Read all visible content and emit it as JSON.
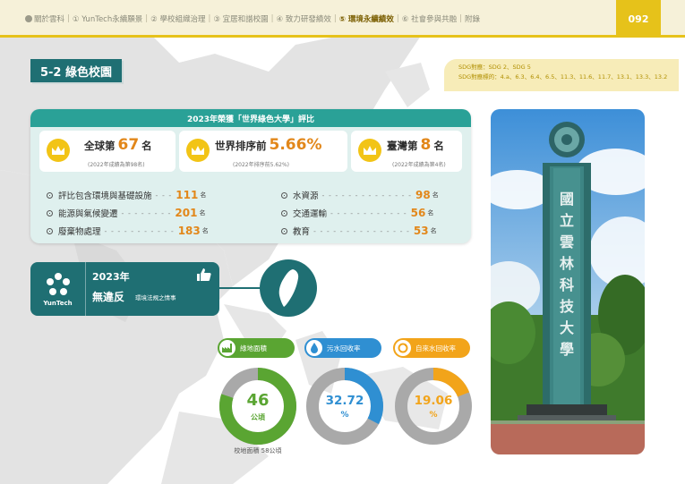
{
  "nav": {
    "items": [
      {
        "label": "關於雲科",
        "active": false
      },
      {
        "label": "① YunTech永續願景",
        "active": false
      },
      {
        "label": "② 學校組織治理",
        "active": false
      },
      {
        "label": "③ 宜居和諧校園",
        "active": false
      },
      {
        "label": "④ 致力研發績效",
        "active": false
      },
      {
        "label": "⑤ 環境永續績效",
        "active": true
      },
      {
        "label": "⑥ 社會參與共融",
        "active": false
      },
      {
        "label": "附錄",
        "active": false
      }
    ],
    "page_number": "092"
  },
  "title": "5-2 綠色校園",
  "sdg_note": {
    "line1": "SDG對應：SDG 2、SDG 5",
    "line2": "SDG對應標的：4.a、6.3、6.4、6.5、11.3、11.6、11.7、13.1、13.3、13.2"
  },
  "ranking": {
    "header": "2023年榮獲「世界綠色大學」評比",
    "stats": [
      {
        "prefix": "全球第",
        "value": "67",
        "suffix": "名",
        "note": "(2022年成績為第98名)"
      },
      {
        "prefix": "世界排序前",
        "value": "5.66%",
        "suffix": "",
        "note": "(2022年排序前5.62%)"
      },
      {
        "prefix": "臺灣第",
        "value": "8",
        "suffix": "名",
        "note": "(2022年成績為第4名)"
      }
    ],
    "left_items": [
      {
        "label": "評比包含環境與基礎設施",
        "value": "111",
        "unit": "名"
      },
      {
        "label": "能源與氣候變遷",
        "value": "201",
        "unit": "名"
      },
      {
        "label": "廢棄物處理",
        "value": "183",
        "unit": "名"
      }
    ],
    "right_items": [
      {
        "label": "水資源",
        "value": "98",
        "unit": "名"
      },
      {
        "label": "交通運輸",
        "value": "56",
        "unit": "名"
      },
      {
        "label": "教育",
        "value": "53",
        "unit": "名"
      }
    ]
  },
  "violation": {
    "logo_text": "YunTech",
    "year": "2023年",
    "headline": "無違反",
    "detail": "環境法規之情事"
  },
  "metrics": [
    {
      "label": "綠地面積",
      "value": "46",
      "unit": "公頃",
      "fraction": 0.8,
      "color": "#5aa532"
    },
    {
      "label": "污水回收率",
      "value": "32.72",
      "unit": "%",
      "fraction": 0.3272,
      "color": "#2f8fd2"
    },
    {
      "label": "自來水回收率",
      "value": "19.06",
      "unit": "%",
      "fraction": 0.1906,
      "color": "#f2a41a"
    }
  ],
  "metric_caption": "校地面積 58公頃",
  "photo": {
    "tower_text": [
      "國",
      "立",
      "雲",
      "林",
      "科",
      "技",
      "大",
      "學"
    ]
  },
  "colors": {
    "teal_dark": "#1f6f73",
    "teal": "#2aa197",
    "yellow": "#e6c21a",
    "orange_text": "#e2871a",
    "donut_track": "#a9a9a9"
  }
}
